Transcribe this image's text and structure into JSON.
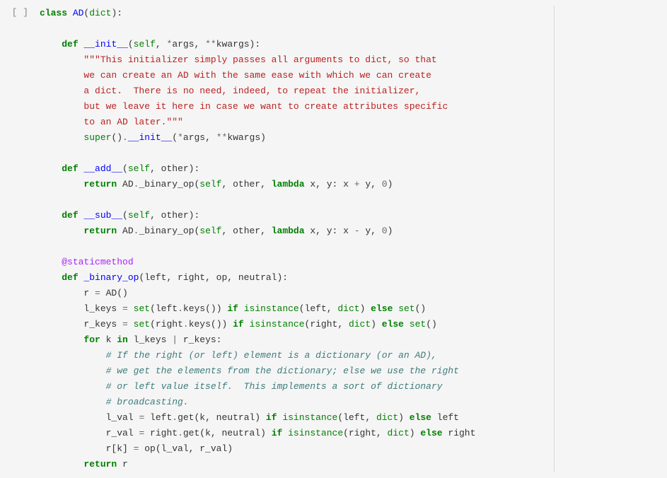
{
  "prompt": "[ ]",
  "code_lines": [
    [
      {
        "t": "class ",
        "c": "k"
      },
      {
        "t": "AD",
        "c": "nc"
      },
      {
        "t": "(",
        "c": "p"
      },
      {
        "t": "dict",
        "c": "bi"
      },
      {
        "t": "):",
        "c": "p"
      }
    ],
    [],
    [
      {
        "t": "    ",
        "c": "p"
      },
      {
        "t": "def ",
        "c": "k"
      },
      {
        "t": "__init__",
        "c": "fn"
      },
      {
        "t": "(",
        "c": "p"
      },
      {
        "t": "self",
        "c": "self"
      },
      {
        "t": ", ",
        "c": "p"
      },
      {
        "t": "*",
        "c": "o"
      },
      {
        "t": "args, ",
        "c": "n"
      },
      {
        "t": "**",
        "c": "o"
      },
      {
        "t": "kwargs):",
        "c": "n"
      }
    ],
    [
      {
        "t": "        ",
        "c": "p"
      },
      {
        "t": "\"\"\"This initializer simply passes all arguments to dict, so that",
        "c": "s"
      }
    ],
    [
      {
        "t": "        ",
        "c": "p"
      },
      {
        "t": "we can create an AD with the same ease with which we can create",
        "c": "s"
      }
    ],
    [
      {
        "t": "        ",
        "c": "p"
      },
      {
        "t": "a dict.  There is no need, indeed, to repeat the initializer,",
        "c": "s"
      }
    ],
    [
      {
        "t": "        ",
        "c": "p"
      },
      {
        "t": "but we leave it here in case we want to create attributes specific",
        "c": "s"
      }
    ],
    [
      {
        "t": "        ",
        "c": "p"
      },
      {
        "t": "to an AD later.\"\"\"",
        "c": "s"
      }
    ],
    [
      {
        "t": "        ",
        "c": "p"
      },
      {
        "t": "super",
        "c": "bi"
      },
      {
        "t": "()",
        "c": "p"
      },
      {
        "t": ".",
        "c": "o"
      },
      {
        "t": "__init__",
        "c": "fn"
      },
      {
        "t": "(",
        "c": "p"
      },
      {
        "t": "*",
        "c": "o"
      },
      {
        "t": "args, ",
        "c": "n"
      },
      {
        "t": "**",
        "c": "o"
      },
      {
        "t": "kwargs)",
        "c": "n"
      }
    ],
    [],
    [
      {
        "t": "    ",
        "c": "p"
      },
      {
        "t": "def ",
        "c": "k"
      },
      {
        "t": "__add__",
        "c": "fn"
      },
      {
        "t": "(",
        "c": "p"
      },
      {
        "t": "self",
        "c": "self"
      },
      {
        "t": ", other):",
        "c": "n"
      }
    ],
    [
      {
        "t": "        ",
        "c": "p"
      },
      {
        "t": "return ",
        "c": "k"
      },
      {
        "t": "AD",
        "c": "n"
      },
      {
        "t": ".",
        "c": "o"
      },
      {
        "t": "_binary_op(",
        "c": "n"
      },
      {
        "t": "self",
        "c": "self"
      },
      {
        "t": ", other, ",
        "c": "n"
      },
      {
        "t": "lambda ",
        "c": "k"
      },
      {
        "t": "x, y: x ",
        "c": "n"
      },
      {
        "t": "+",
        "c": "o"
      },
      {
        "t": " y, ",
        "c": "n"
      },
      {
        "t": "0",
        "c": "num"
      },
      {
        "t": ")",
        "c": "p"
      }
    ],
    [],
    [
      {
        "t": "    ",
        "c": "p"
      },
      {
        "t": "def ",
        "c": "k"
      },
      {
        "t": "__sub__",
        "c": "fn"
      },
      {
        "t": "(",
        "c": "p"
      },
      {
        "t": "self",
        "c": "self"
      },
      {
        "t": ", other):",
        "c": "n"
      }
    ],
    [
      {
        "t": "        ",
        "c": "p"
      },
      {
        "t": "return ",
        "c": "k"
      },
      {
        "t": "AD",
        "c": "n"
      },
      {
        "t": ".",
        "c": "o"
      },
      {
        "t": "_binary_op(",
        "c": "n"
      },
      {
        "t": "self",
        "c": "self"
      },
      {
        "t": ", other, ",
        "c": "n"
      },
      {
        "t": "lambda ",
        "c": "k"
      },
      {
        "t": "x, y: x ",
        "c": "n"
      },
      {
        "t": "-",
        "c": "o"
      },
      {
        "t": " y, ",
        "c": "n"
      },
      {
        "t": "0",
        "c": "num"
      },
      {
        "t": ")",
        "c": "p"
      }
    ],
    [],
    [
      {
        "t": "    ",
        "c": "p"
      },
      {
        "t": "@staticmethod",
        "c": "dec"
      }
    ],
    [
      {
        "t": "    ",
        "c": "p"
      },
      {
        "t": "def ",
        "c": "k"
      },
      {
        "t": "_binary_op",
        "c": "fn"
      },
      {
        "t": "(left, right, op, neutral):",
        "c": "n"
      }
    ],
    [
      {
        "t": "        r ",
        "c": "n"
      },
      {
        "t": "=",
        "c": "o"
      },
      {
        "t": " AD()",
        "c": "n"
      }
    ],
    [
      {
        "t": "        l_keys ",
        "c": "n"
      },
      {
        "t": "=",
        "c": "o"
      },
      {
        "t": " ",
        "c": "n"
      },
      {
        "t": "set",
        "c": "bi"
      },
      {
        "t": "(left",
        "c": "n"
      },
      {
        "t": ".",
        "c": "o"
      },
      {
        "t": "keys()) ",
        "c": "n"
      },
      {
        "t": "if ",
        "c": "k"
      },
      {
        "t": "isinstance",
        "c": "bi"
      },
      {
        "t": "(left, ",
        "c": "n"
      },
      {
        "t": "dict",
        "c": "bi"
      },
      {
        "t": ") ",
        "c": "p"
      },
      {
        "t": "else ",
        "c": "k"
      },
      {
        "t": "set",
        "c": "bi"
      },
      {
        "t": "()",
        "c": "p"
      }
    ],
    [
      {
        "t": "        r_keys ",
        "c": "n"
      },
      {
        "t": "=",
        "c": "o"
      },
      {
        "t": " ",
        "c": "n"
      },
      {
        "t": "set",
        "c": "bi"
      },
      {
        "t": "(right",
        "c": "n"
      },
      {
        "t": ".",
        "c": "o"
      },
      {
        "t": "keys()) ",
        "c": "n"
      },
      {
        "t": "if ",
        "c": "k"
      },
      {
        "t": "isinstance",
        "c": "bi"
      },
      {
        "t": "(right, ",
        "c": "n"
      },
      {
        "t": "dict",
        "c": "bi"
      },
      {
        "t": ") ",
        "c": "p"
      },
      {
        "t": "else ",
        "c": "k"
      },
      {
        "t": "set",
        "c": "bi"
      },
      {
        "t": "()",
        "c": "p"
      }
    ],
    [
      {
        "t": "        ",
        "c": "p"
      },
      {
        "t": "for ",
        "c": "k"
      },
      {
        "t": "k ",
        "c": "n"
      },
      {
        "t": "in ",
        "c": "k"
      },
      {
        "t": "l_keys ",
        "c": "n"
      },
      {
        "t": "|",
        "c": "o"
      },
      {
        "t": " r_keys:",
        "c": "n"
      }
    ],
    [
      {
        "t": "            ",
        "c": "p"
      },
      {
        "t": "# If the right (or left) element is a dictionary (or an AD),",
        "c": "c"
      }
    ],
    [
      {
        "t": "            ",
        "c": "p"
      },
      {
        "t": "# we get the elements from the dictionary; else we use the right",
        "c": "c"
      }
    ],
    [
      {
        "t": "            ",
        "c": "p"
      },
      {
        "t": "# or left value itself.  This implements a sort of dictionary",
        "c": "c"
      }
    ],
    [
      {
        "t": "            ",
        "c": "p"
      },
      {
        "t": "# broadcasting.",
        "c": "c"
      }
    ],
    [
      {
        "t": "            l_val ",
        "c": "n"
      },
      {
        "t": "=",
        "c": "o"
      },
      {
        "t": " left",
        "c": "n"
      },
      {
        "t": ".",
        "c": "o"
      },
      {
        "t": "get(k, neutral) ",
        "c": "n"
      },
      {
        "t": "if ",
        "c": "k"
      },
      {
        "t": "isinstance",
        "c": "bi"
      },
      {
        "t": "(left, ",
        "c": "n"
      },
      {
        "t": "dict",
        "c": "bi"
      },
      {
        "t": ") ",
        "c": "p"
      },
      {
        "t": "else ",
        "c": "k"
      },
      {
        "t": "left",
        "c": "n"
      }
    ],
    [
      {
        "t": "            r_val ",
        "c": "n"
      },
      {
        "t": "=",
        "c": "o"
      },
      {
        "t": " right",
        "c": "n"
      },
      {
        "t": ".",
        "c": "o"
      },
      {
        "t": "get(k, neutral) ",
        "c": "n"
      },
      {
        "t": "if ",
        "c": "k"
      },
      {
        "t": "isinstance",
        "c": "bi"
      },
      {
        "t": "(right, ",
        "c": "n"
      },
      {
        "t": "dict",
        "c": "bi"
      },
      {
        "t": ") ",
        "c": "p"
      },
      {
        "t": "else ",
        "c": "k"
      },
      {
        "t": "right",
        "c": "n"
      }
    ],
    [
      {
        "t": "            r[k] ",
        "c": "n"
      },
      {
        "t": "=",
        "c": "o"
      },
      {
        "t": " op(l_val, r_val)",
        "c": "n"
      }
    ],
    [
      {
        "t": "        ",
        "c": "p"
      },
      {
        "t": "return ",
        "c": "k"
      },
      {
        "t": "r",
        "c": "n"
      }
    ]
  ]
}
